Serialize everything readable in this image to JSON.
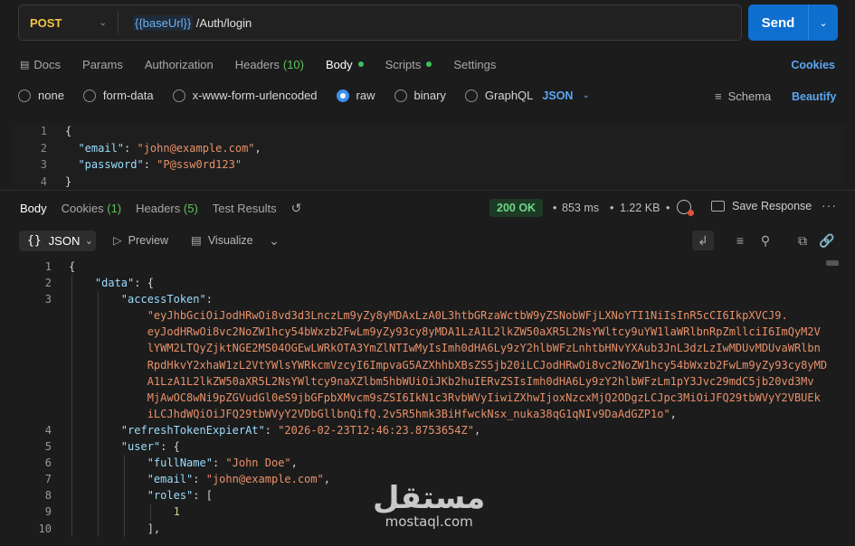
{
  "request": {
    "method": "POST",
    "url_variable": "{{baseUrl}}",
    "url_path": " /Auth/login",
    "send_label": "Send"
  },
  "request_tabs": [
    {
      "label": "Docs"
    },
    {
      "label": "Params"
    },
    {
      "label": "Authorization"
    },
    {
      "label": "Headers",
      "count": "(10)"
    },
    {
      "label": "Body"
    },
    {
      "label": "Scripts"
    },
    {
      "label": "Settings"
    }
  ],
  "cookies_link": "Cookies",
  "body_types": [
    "none",
    "form-data",
    "x-www-form-urlencoded",
    "raw",
    "binary",
    "GraphQL"
  ],
  "body_format": "JSON",
  "schema_label": "Schema",
  "beautify_label": "Beautify",
  "request_body_lines": [
    {
      "num": "1",
      "text": "{"
    },
    {
      "num": "2",
      "key": "\"email\"",
      "value": "\"john@example.com\"",
      "trail": ","
    },
    {
      "num": "3",
      "key": "\"password\"",
      "value": "\"P@ssw0rd123\"",
      "trail": ""
    },
    {
      "num": "4",
      "text": "}"
    }
  ],
  "response_tabs": [
    {
      "label": "Body"
    },
    {
      "label": "Cookies",
      "count": "(1)"
    },
    {
      "label": "Headers",
      "count": "(5)"
    },
    {
      "label": "Test Results"
    }
  ],
  "response_meta": {
    "status": "200 OK",
    "time": "853 ms",
    "size": "1.22 KB",
    "save_response": "Save Response"
  },
  "response_toolbar": {
    "view": "JSON",
    "preview": "Preview",
    "visualize": "Visualize"
  },
  "response_lines": [
    {
      "num": "1",
      "indent": 0,
      "parts": [
        [
          "p",
          "{"
        ]
      ]
    },
    {
      "num": "2",
      "indent": 1,
      "parts": [
        [
          "k",
          "\"data\""
        ],
        [
          "p",
          ": {"
        ]
      ]
    },
    {
      "num": "3",
      "indent": 2,
      "parts": [
        [
          "k",
          "\"accessToken\""
        ],
        [
          "p",
          ":"
        ]
      ]
    },
    {
      "num": "",
      "indent": 3,
      "parts": [
        [
          "s",
          "\"eyJhbGciOiJodHRwOi8vd3d3LnczLm9yZy8yMDAxLzA0L3htbGRzaWctbW9yZSNobWFjLXNoYTI1NiIsInR5cCI6IkpXVCJ9."
        ]
      ]
    },
    {
      "num": "",
      "indent": 3,
      "parts": [
        [
          "s",
          "eyJodHRwOi8vc2NoZW1hcy54bWxzb2FwLm9yZy93cy8yMDA1LzA1L2lkZW50aXR5L2NsYWltcy9uYW1laWRlbnRpZmllciI6ImQyM2V"
        ]
      ]
    },
    {
      "num": "",
      "indent": 3,
      "parts": [
        [
          "s",
          "lYWM2LTQyZjktNGE2MS04OGEwLWRkOTA3YmZlNTIwMyIsImh0dHA6Ly9zY2hlbWFzLnhtbHNvYXAub3JnL3dzLzIwMDUvMDUvaWRlbn"
        ]
      ]
    },
    {
      "num": "",
      "indent": 3,
      "parts": [
        [
          "s",
          "RpdHkvY2xhaW1zL2VtYWlsYWRkcmVzcyI6ImpvaG5AZXhhbXBsZS5jb20iLCJodHRwOi8vc2NoZW1hcy54bWxzb2FwLm9yZy93cy8yMD"
        ]
      ]
    },
    {
      "num": "",
      "indent": 3,
      "parts": [
        [
          "s",
          "A1LzA1L2lkZW50aXR5L2NsYWltcy9naXZlbm5hbWUiOiJKb2huIERvZSIsImh0dHA6Ly9zY2hlbWFzLm1pY3Jvc29mdC5jb20vd3Mv"
        ]
      ]
    },
    {
      "num": "",
      "indent": 3,
      "parts": [
        [
          "s",
          "MjAwOC8wNi9pZGVudGl0eS9jbGFpbXMvcm9sZSI6IkN1c3RvbWVyIiwiZXhwIjoxNzcxMjQ2ODgzLCJpc3MiOiJFQ29tbWVyY2VBUEk"
        ]
      ]
    },
    {
      "num": "",
      "indent": 3,
      "parts": [
        [
          "s",
          "iLCJhdWQiOiJFQ29tbWVyY2VDbGllbnQifQ.2v5R5hmk3BiHfwckNsx_nuka38qG1qNIv9DaAdGZP1o\""
        ],
        [
          "p",
          ","
        ]
      ]
    },
    {
      "num": "4",
      "indent": 2,
      "parts": [
        [
          "k",
          "\"refreshTokenExpierAt\""
        ],
        [
          "p",
          ": "
        ],
        [
          "s",
          "\"2026-02-23T12:46:23.8753654Z\""
        ],
        [
          "p",
          ","
        ]
      ]
    },
    {
      "num": "5",
      "indent": 2,
      "parts": [
        [
          "k",
          "\"user\""
        ],
        [
          "p",
          ": {"
        ]
      ]
    },
    {
      "num": "6",
      "indent": 3,
      "parts": [
        [
          "k",
          "\"fullName\""
        ],
        [
          "p",
          ": "
        ],
        [
          "s",
          "\"John Doe\""
        ],
        [
          "p",
          ","
        ]
      ]
    },
    {
      "num": "7",
      "indent": 3,
      "parts": [
        [
          "k",
          "\"email\""
        ],
        [
          "p",
          ": "
        ],
        [
          "s",
          "\"john@example.com\""
        ],
        [
          "p",
          ","
        ]
      ]
    },
    {
      "num": "8",
      "indent": 3,
      "parts": [
        [
          "k",
          "\"roles\""
        ],
        [
          "p",
          ": ["
        ]
      ]
    },
    {
      "num": "9",
      "indent": 4,
      "parts": [
        [
          "n",
          "1"
        ]
      ]
    },
    {
      "num": "10",
      "indent": 3,
      "parts": [
        [
          "p",
          "],"
        ]
      ]
    }
  ],
  "watermark": {
    "arabic": "مستقل",
    "latin": "mostaql.com"
  }
}
